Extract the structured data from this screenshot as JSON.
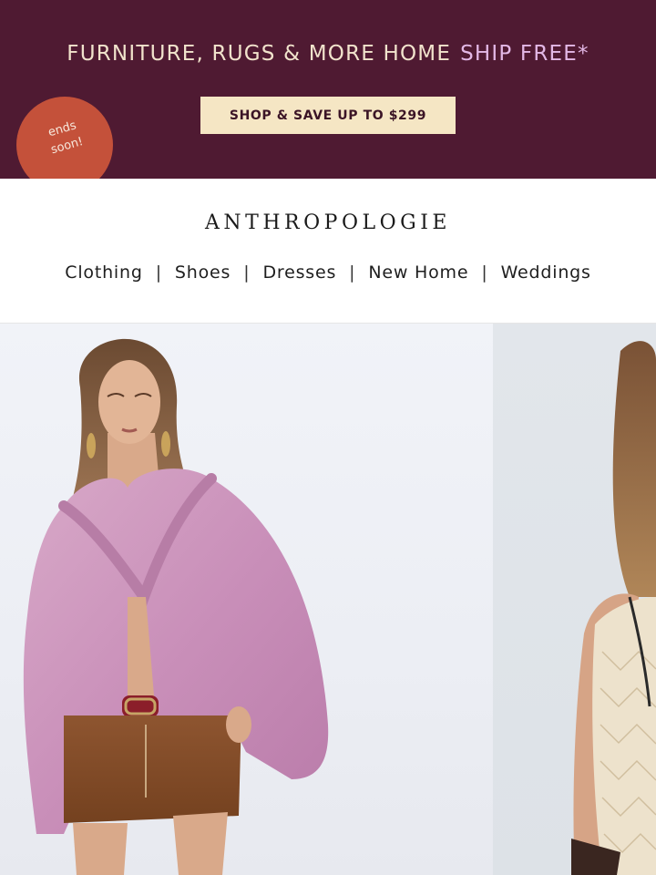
{
  "promo": {
    "headline": "FURNITURE, RUGS & MORE HOME",
    "headline_accent": "SHIP FREE*",
    "cta_label": "SHOP & SAVE UP TO $299",
    "badge_line1": "ends",
    "badge_line2": "soon!",
    "colors": {
      "background": "#4f1a32",
      "cta_background": "#f5e6c4",
      "badge": "#c4513a",
      "accent": "#e3b8e6"
    }
  },
  "header": {
    "logo": "ANTHROPOLOGIE",
    "nav": [
      {
        "label": "Clothing"
      },
      {
        "label": "Shoes"
      },
      {
        "label": "Dresses"
      },
      {
        "label": "New Home"
      },
      {
        "label": "Weddings"
      }
    ],
    "separator": "|"
  },
  "hero": {
    "images": [
      {
        "name": "model-pink-ruffle-blouse"
      },
      {
        "name": "model-crochet-top"
      }
    ]
  }
}
